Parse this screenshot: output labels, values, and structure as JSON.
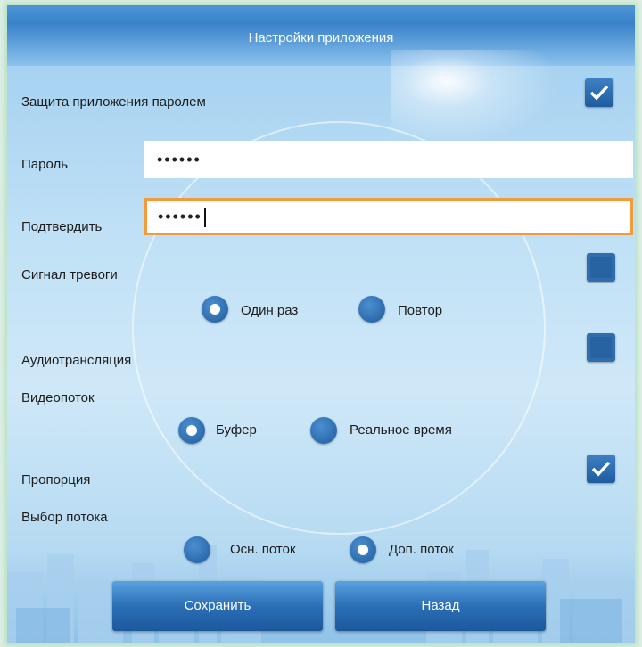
{
  "header": {
    "title": "Настройки приложения"
  },
  "settings": {
    "password_protection": {
      "label": "Защита приложения паролем",
      "checked": true
    },
    "password": {
      "label": "Пароль",
      "value": "••••••"
    },
    "confirm": {
      "label": "Подтвердить",
      "value": "••••••"
    },
    "alarm": {
      "label": "Сигнал тревоги",
      "checked": false,
      "options": [
        "Один раз",
        "Повтор"
      ],
      "selected": "Один раз"
    },
    "audio": {
      "label": "Аудиотрансляция",
      "checked": false
    },
    "video": {
      "label": "Видеопоток",
      "options": [
        "Буфер",
        "Реальное время"
      ],
      "selected": "Буфер"
    },
    "proportion": {
      "label": "Пропорция",
      "checked": true
    },
    "stream": {
      "label": "Выбор потока",
      "options": [
        "Осн. поток",
        "Доп. поток"
      ],
      "selected": "Доп. поток"
    }
  },
  "buttons": {
    "save": "Сохранить",
    "back": "Назад"
  },
  "colors": {
    "accent": "#2b6fb6",
    "focus_border": "#f29a3c",
    "header": "#3a82c9"
  }
}
